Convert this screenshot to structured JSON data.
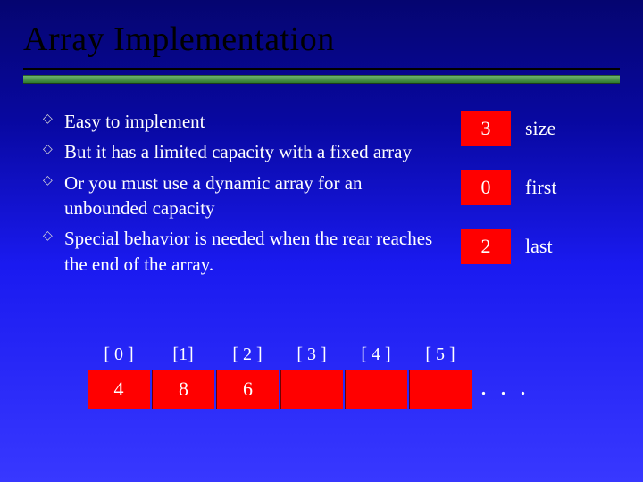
{
  "title": "Array Implementation",
  "bullets": [
    "Easy to implement",
    "But it has a limited capacity with a fixed array",
    "Or you must use a dynamic array for an unbounded capacity",
    "Special behavior is needed when the rear reaches the end of the array."
  ],
  "side": [
    {
      "value": "3",
      "label": "size"
    },
    {
      "value": "0",
      "label": "first"
    },
    {
      "value": "2",
      "label": "last"
    }
  ],
  "array": {
    "indices": [
      "[ 0 ]",
      "[1]",
      "[ 2 ]",
      "[ 3 ]",
      "[ 4 ]",
      "[ 5 ]"
    ],
    "values": [
      "4",
      "8",
      "6",
      "",
      "",
      ""
    ],
    "ellipsis": ". . ."
  }
}
